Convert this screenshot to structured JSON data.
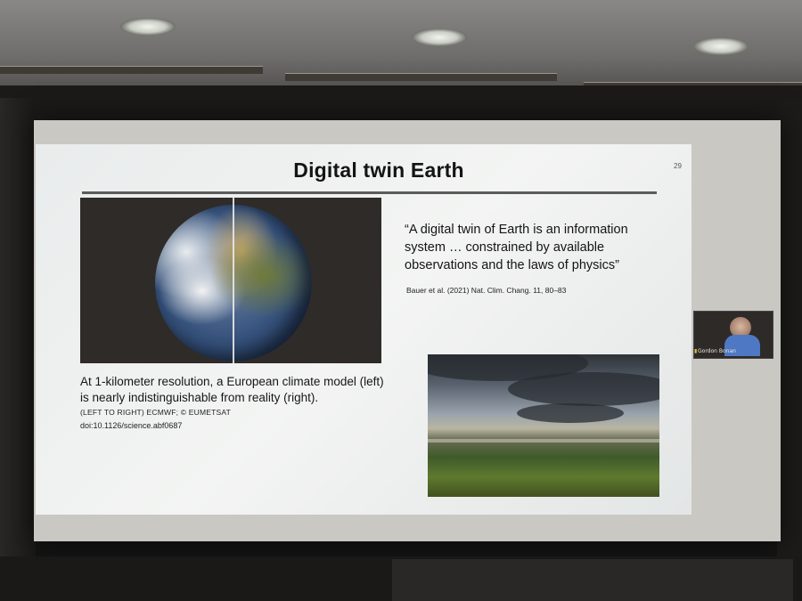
{
  "slide": {
    "title": "Digital twin Earth",
    "number": "29",
    "caption": "At 1-kilometer resolution, a European climate model (left) is nearly indistinguishable from reality (right).",
    "credit": "(LEFT TO RIGHT) ECMWF; © EUMETSAT",
    "doi": "doi:10.1126/science.abf0687",
    "quote": "“A digital twin of Earth is an information system … constrained by available observations and the laws of physics”",
    "citation": "Bauer et al. (2021) Nat. Clim. Chang. 11, 80–83"
  },
  "video_tile": {
    "participant_name": "Gordon Bonan",
    "signal_icon": "signal-bars-icon"
  },
  "colors": {
    "slide_background": "#eef0ef",
    "title_rule": "#5b5b5b",
    "globe_panel": "#2f2b28",
    "room": "#141414"
  }
}
